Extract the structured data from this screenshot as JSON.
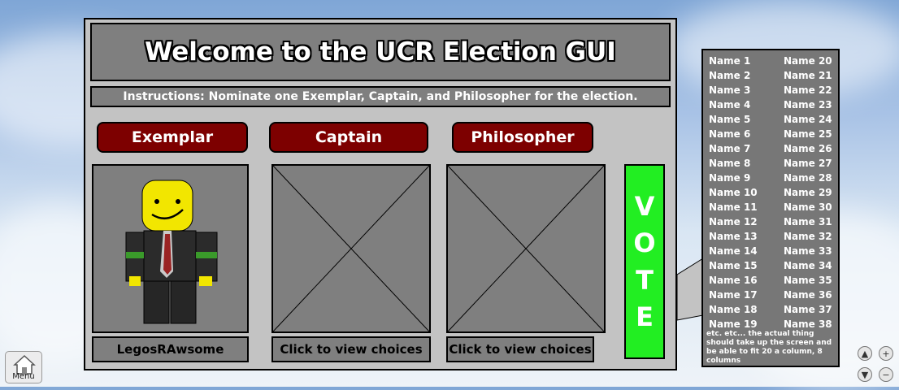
{
  "title": "Welcome to the UCR Election GUI",
  "instructions": "Instructions: Nominate one Exemplar, Captain, and Philosopher for the election.",
  "categories": [
    "Exemplar",
    "Captain",
    "Philosopher"
  ],
  "slots": [
    {
      "caption": "LegosRAwsome",
      "state": "selected-avatar"
    },
    {
      "caption": "Click to view choices",
      "state": "empty"
    },
    {
      "caption": "Click to view choices",
      "state": "empty"
    }
  ],
  "vote_letters": [
    "V",
    "O",
    "T",
    "E"
  ],
  "names_col1": [
    "Name 1",
    "Name 2",
    "Name 3",
    "Name 4",
    "Name 5",
    "Name 6",
    "Name 7",
    "Name 8",
    "Name 9",
    "Name 10",
    "Name 11",
    "Name 12",
    "Name 13",
    "Name 14",
    "Name 15",
    "Name 16",
    "Name 17",
    "Name 18",
    "Name 19"
  ],
  "names_col2": [
    "Name 20",
    "Name 21",
    "Name 22",
    "Name 23",
    "Name 24",
    "Name 25",
    "Name 26",
    "Name 27",
    "Name 28",
    "Name 29",
    "Name 30",
    "Name 31",
    "Name 32",
    "Name 33",
    "Name 34",
    "Name 35",
    "Name 36",
    "Name 37",
    "Name 38"
  ],
  "names_note": "etc. etc... the actual thing should take up the screen and be able to fit 20 a column, 8 columns",
  "menu_label": "Menu",
  "colors": {
    "accent_red": "#7d0000",
    "vote_green": "#22ee22",
    "panel_gray": "#c3c3c3",
    "box_gray": "#7f7f7f"
  }
}
